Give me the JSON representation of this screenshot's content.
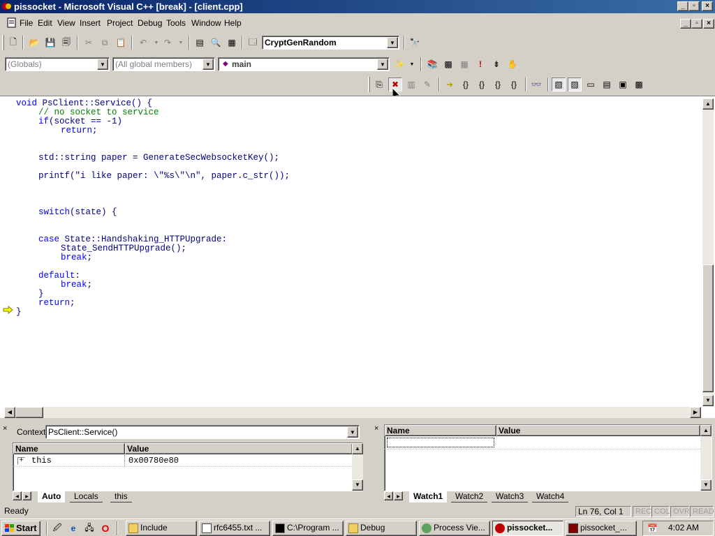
{
  "window": {
    "title": "pissocket - Microsoft Visual C++ [break] - [client.cpp]"
  },
  "menu": [
    "File",
    "Edit",
    "View",
    "Insert",
    "Project",
    "Debug",
    "Tools",
    "Window",
    "Help"
  ],
  "toolbar": {
    "find_combo_value": "CryptGenRandom"
  },
  "wizardbar": {
    "class_combo": "(Globals)",
    "members_combo": "(All global members)",
    "function_combo": "main"
  },
  "code_lines": [
    {
      "row": 0,
      "indent": 0,
      "parts": [
        [
          "kw",
          "void"
        ],
        [
          "tx",
          " PsClient::Service() {"
        ]
      ]
    },
    {
      "row": 1,
      "indent": 4,
      "parts": [
        [
          "cm",
          "// no socket to service"
        ]
      ]
    },
    {
      "row": 2,
      "indent": 4,
      "parts": [
        [
          "kw",
          "if"
        ],
        [
          "tx",
          "(socket == -1)"
        ]
      ]
    },
    {
      "row": 3,
      "indent": 8,
      "parts": [
        [
          "kw",
          "return"
        ],
        [
          "tx",
          ";"
        ]
      ]
    },
    {
      "row": 6,
      "indent": 4,
      "parts": [
        [
          "tx",
          "std::string paper = GenerateSecWebsocketKey();"
        ]
      ]
    },
    {
      "row": 8,
      "indent": 4,
      "parts": [
        [
          "tx",
          "printf(\"i like paper: \\\"%s\\\"\\n\", paper.c_str());"
        ]
      ]
    },
    {
      "row": 12,
      "indent": 4,
      "parts": [
        [
          "kw",
          "switch"
        ],
        [
          "tx",
          "(state) {"
        ]
      ]
    },
    {
      "row": 15,
      "indent": 4,
      "parts": [
        [
          "kw",
          "case"
        ],
        [
          "tx",
          " State::Handshaking_HTTPUpgrade:"
        ]
      ]
    },
    {
      "row": 16,
      "indent": 8,
      "parts": [
        [
          "tx",
          "State_SendHTTPUpgrade();"
        ]
      ]
    },
    {
      "row": 17,
      "indent": 8,
      "parts": [
        [
          "kw",
          "break"
        ],
        [
          "tx",
          ";"
        ]
      ]
    },
    {
      "row": 19,
      "indent": 4,
      "parts": [
        [
          "kw",
          "default"
        ],
        [
          "tx",
          ":"
        ]
      ]
    },
    {
      "row": 20,
      "indent": 8,
      "parts": [
        [
          "kw",
          "break"
        ],
        [
          "tx",
          ";"
        ]
      ]
    },
    {
      "row": 21,
      "indent": 4,
      "parts": [
        [
          "tx",
          "}"
        ]
      ]
    },
    {
      "row": 22,
      "indent": 4,
      "parts": [
        [
          "kw",
          "return"
        ],
        [
          "tx",
          ";"
        ]
      ]
    },
    {
      "row": 23,
      "indent": 0,
      "parts": [
        [
          "tx",
          "}"
        ]
      ]
    }
  ],
  "variables": {
    "context_label": "Context:",
    "context_value": "PsClient::Service()",
    "col_name": "Name",
    "col_value": "Value",
    "rows": [
      {
        "expander": "+",
        "name": "this",
        "value": "0x00780e80"
      }
    ],
    "tabs": [
      "Auto",
      "Locals",
      "this"
    ]
  },
  "watch": {
    "col_name": "Name",
    "col_value": "Value",
    "tabs": [
      "Watch1",
      "Watch2",
      "Watch3",
      "Watch4"
    ]
  },
  "status": {
    "text": "Ready",
    "position": "Ln 76, Col 1",
    "indicators": [
      "REC",
      "COL",
      "OVR",
      "READ"
    ]
  },
  "taskbar": {
    "start": "Start",
    "tasks": [
      {
        "label": "Include",
        "active": false
      },
      {
        "label": "rfc6455.txt ...",
        "active": false
      },
      {
        "label": "C:\\Program ...",
        "active": false
      },
      {
        "label": "Debug",
        "active": false
      },
      {
        "label": "Process Vie...",
        "active": false
      },
      {
        "label": "pissocket...",
        "active": true
      },
      {
        "label": "pissocket_...",
        "active": false
      }
    ],
    "clock": "4:02 AM"
  }
}
